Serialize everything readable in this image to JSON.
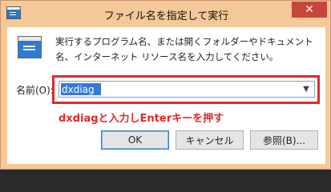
{
  "window": {
    "title": "ファイル名を指定して実行",
    "close_label": "✕"
  },
  "dialog": {
    "description": "実行するプログラム名、または開くフォルダーやドキュメント名、インターネット リソース名を入力してください。",
    "open_label": "名前(O):",
    "input_value": "dxdiag",
    "annotation": "dxdiagと入力しEnterキーを押す"
  },
  "buttons": {
    "ok": "OK",
    "cancel": "キャンセル",
    "browse": "参照(B)..."
  },
  "colors": {
    "frame": "#f5c89a",
    "close": "#c7463c",
    "highlight": "#e4282b",
    "selection": "#3479d7"
  }
}
